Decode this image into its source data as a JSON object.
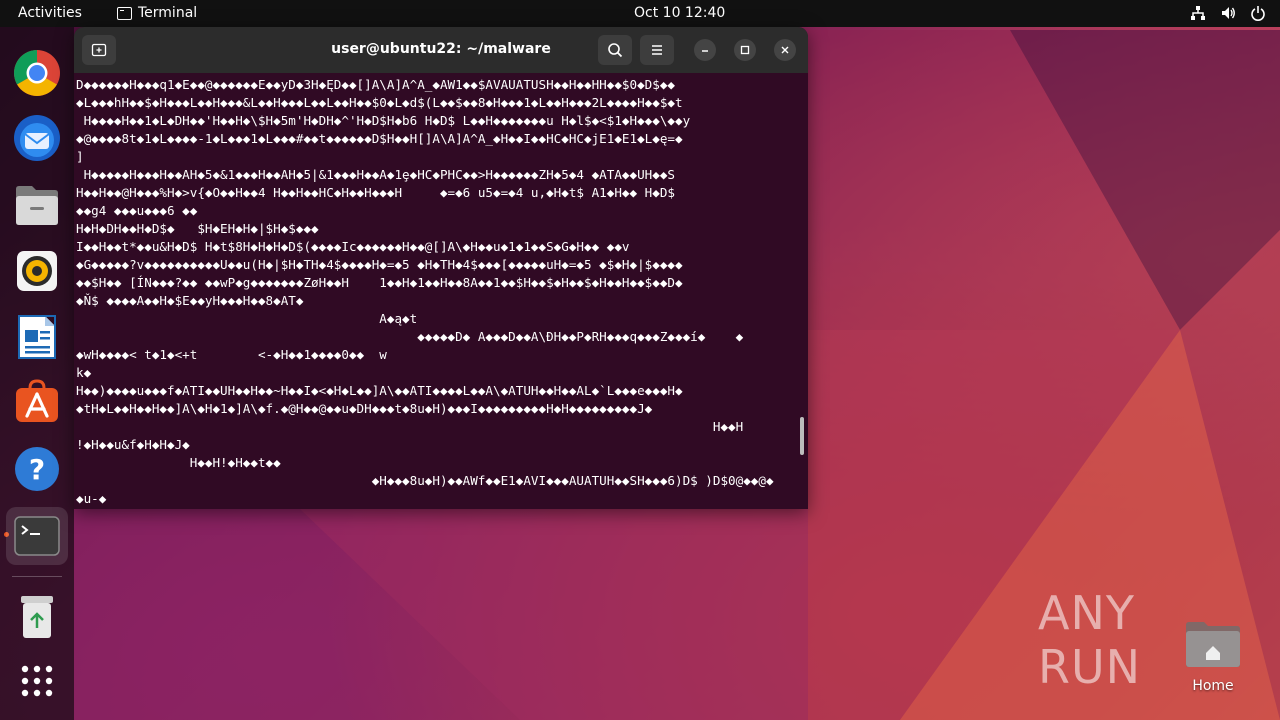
{
  "topbar": {
    "activities": "Activities",
    "app_name": "Terminal",
    "clock": "Oct 10  12:40"
  },
  "dock": {
    "items": [
      {
        "name": "chrome"
      },
      {
        "name": "thunderbird"
      },
      {
        "name": "files"
      },
      {
        "name": "rhythmbox"
      },
      {
        "name": "libreoffice-writer"
      },
      {
        "name": "app-center"
      },
      {
        "name": "help"
      },
      {
        "name": "terminal",
        "running": true
      },
      {
        "name": "trash"
      },
      {
        "name": "show-apps"
      }
    ]
  },
  "terminal": {
    "title": "user@ubuntu22: ~/malware",
    "lines": [
      "D◆◆◆◆◆◆H◆◆◆q1◆E◆◆@◆◆◆◆◆◆E◆◆yD◆3H◆ĘD◆◆[]A\\A]A^A_◆AW1◆◆$AVAUATUSH◆◆H◆◆HH◆◆$0◆D$◆◆",
      "◆L◆◆◆hH◆◆$◆H◆◆◆L◆◆H◆◆◆&L◆◆H◆◆◆L◆◆L◆◆H◆◆$0◆L◆d$(L◆◆$◆◆8◆H◆◆◆1◆L◆◆H◆◆◆2L◆◆◆◆H◆◆$◆t",
      " H◆◆◆◆H◆◆1◆L◆DH◆◆'H◆◆H◆\\$H◆5m'H◆DH◆^'H◆D$H◆b6 H◆D$ L◆◆H◆◆◆◆◆◆◆u H◆l$◆<$1◆H◆◆◆\\◆◆y",
      "◆@◆◆◆◆8t◆1◆L◆◆◆◆-1◆L◆◆◆1◆L◆◆◆#◆◆t◆◆◆◆◆◆D$H◆◆H[]A\\A]A^A_◆H◆◆I◆◆HC◆HC◆jE1◆E1◆L◆ę=◆",
      "]",
      " H◆◆◆◆◆H◆◆◆H◆◆AH◆5◆&1◆◆◆H◆◆AH◆5|&1◆◆◆H◆◆A◆1ȩ◆HC◆PHC◆◆>H◆◆◆◆◆◆ZH◆5◆4 ◆ATA◆◆UH◆◆S",
      "H◆◆H◆◆@H◆◆◆%H◆>v{◆O◆◆H◆◆4 H◆◆H◆◆HC◆H◆◆H◆◆◆H     ◆=◆6 u5◆=◆4 u,◆H◆t$ A1◆H◆◆ H◆D$",
      "◆◆g4 ◆◆◆u◆◆◆6 ◆◆",
      "H◆H◆DH◆◆H◆D$◆   $H◆EH◆H◆|$H◆$◆◆◆",
      "I◆◆H◆◆t*◆◆u&H◆D$ H◆t$8H◆H◆H◆D$(◆◆◆◆Ic◆◆◆◆◆◆H◆◆@[]A\\◆H◆◆u◆1◆1◆◆S◆G◆H◆◆ ◆◆v",
      "◆G◆◆◆◆◆?v◆◆◆◆◆◆◆◆◆◆U◆◆u(H◆|$H◆TH◆4$◆◆◆◆H◆=◆5 ◆H◆TH◆4$◆◆◆[◆◆◆◆◆uH◆=◆5 ◆$◆H◆|$◆◆◆◆",
      "◆◆$H◆◆ [ÍN◆◆◆?◆◆ ◆◆wP◆g◆◆◆◆◆◆◆ZøH◆◆H    1◆◆H◆1◆◆H◆◆8A◆◆1◆◆$H◆◆$◆H◆◆$◆H◆◆H◆◆$◆◆D◆",
      "◆Ň$ ◆◆◆◆A◆◆H◆$E◆◆yH◆◆◆H◆◆8◆AT◆",
      "                                        A◆ą◆t",
      "                                             ◆◆◆◆◆D◆ A◆◆◆D◆◆A\\ĐH◆◆P◆RH◆◆◆q◆◆◆Z◆◆◆í◆    ◆",
      "◆wH◆◆◆◆< t◆1◆<+t        <-◆H◆◆1◆◆◆◆0◆◆  w",
      "k◆",
      "H◆◆)◆◆◆◆u◆◆◆f◆ATI◆◆UH◆◆H◆◆~H◆◆I◆<◆H◆L◆◆]A\\◆◆ATI◆◆◆◆L◆◆A\\◆ATUH◆◆H◆◆AL◆`L◆◆◆e◆◆◆H◆",
      "◆tH◆L◆◆H◆◆H◆◆]A\\◆H◆1◆]A\\◆f.◆@H◆◆@◆◆u◆DH◆◆◆t◆8u◆H)◆◆◆I◆◆◆◆◆◆◆◆◆H◆H◆◆◆◆◆◆◆◆◆J◆",
      "                                                                                    H◆◆H",
      "!◆H◆◆u&f◆H◆H◆J◆",
      "               H◆◆H!◆H◆◆t◆◆",
      "                                       ◆H◆◆◆8u◆H)◆◆AWf◆◆E1◆AVI◆◆◆AUATUH◆◆SH◆◆◆6)D$ )D$0@◆◆@◆",
      "◆u-◆"
    ]
  },
  "desktop": {
    "home_label": "Home",
    "watermark": "ANY RUN"
  }
}
